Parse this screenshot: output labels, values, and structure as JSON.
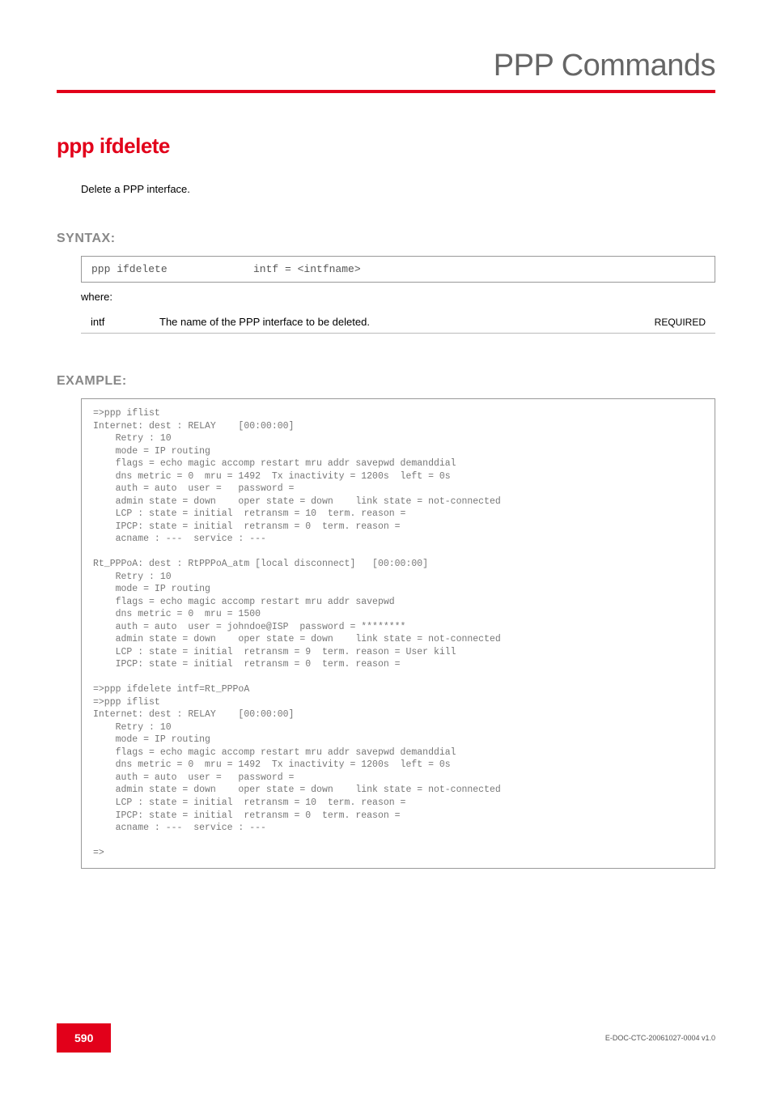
{
  "header": {
    "title": "PPP Commands"
  },
  "command": {
    "name": "ppp ifdelete",
    "description": "Delete a PPP interface."
  },
  "syntax": {
    "heading": "SYNTAX:",
    "cmd": "ppp ifdelete",
    "args": "intf = <intfname>",
    "where": "where:",
    "param_name": "intf",
    "param_desc": "The name of the PPP interface to be deleted.",
    "param_req": "REQUIRED"
  },
  "example": {
    "heading": "EXAMPLE:",
    "content": "=>ppp iflist\nInternet: dest : RELAY    [00:00:00]\n    Retry : 10\n    mode = IP routing\n    flags = echo magic accomp restart mru addr savepwd demanddial\n    dns metric = 0  mru = 1492  Tx inactivity = 1200s  left = 0s\n    auth = auto  user =   password =\n    admin state = down    oper state = down    link state = not-connected\n    LCP : state = initial  retransm = 10  term. reason =\n    IPCP: state = initial  retransm = 0  term. reason =\n    acname : ---  service : ---\n\nRt_PPPoA: dest : RtPPPoA_atm [local disconnect]   [00:00:00]\n    Retry : 10\n    mode = IP routing\n    flags = echo magic accomp restart mru addr savepwd\n    dns metric = 0  mru = 1500\n    auth = auto  user = johndoe@ISP  password = ********\n    admin state = down    oper state = down    link state = not-connected\n    LCP : state = initial  retransm = 9  term. reason = User kill\n    IPCP: state = initial  retransm = 0  term. reason =\n\n=>ppp ifdelete intf=Rt_PPPoA\n=>ppp iflist\nInternet: dest : RELAY    [00:00:00]\n    Retry : 10\n    mode = IP routing\n    flags = echo magic accomp restart mru addr savepwd demanddial\n    dns metric = 0  mru = 1492  Tx inactivity = 1200s  left = 0s\n    auth = auto  user =   password =\n    admin state = down    oper state = down    link state = not-connected\n    LCP : state = initial  retransm = 10  term. reason =\n    IPCP: state = initial  retransm = 0  term. reason =\n    acname : ---  service : ---\n\n=>"
  },
  "footer": {
    "page": "590",
    "docid": "E-DOC-CTC-20061027-0004 v1.0"
  }
}
